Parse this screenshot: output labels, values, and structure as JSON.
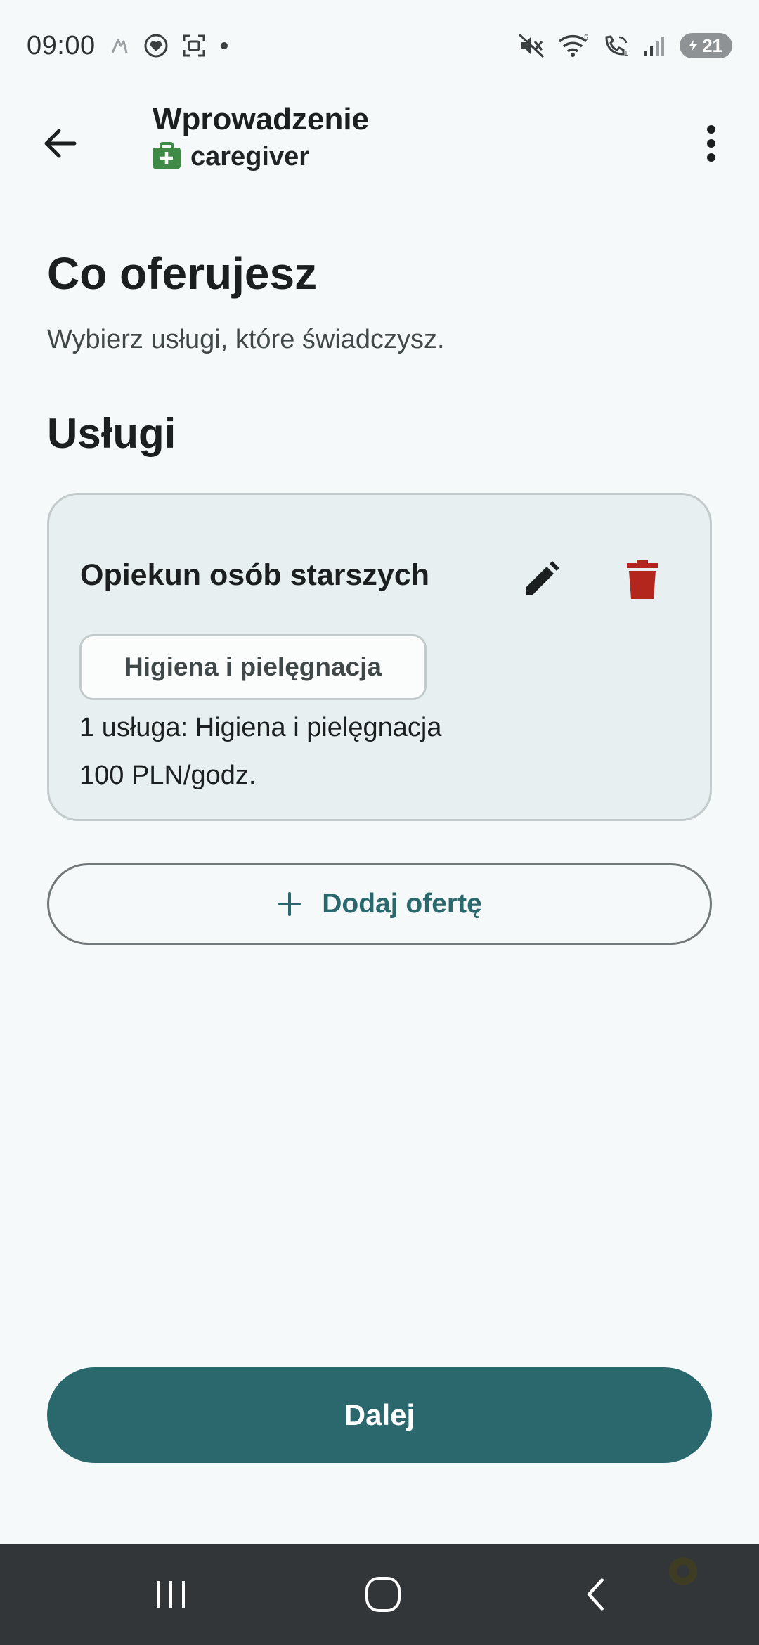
{
  "status_bar": {
    "time": "09:00",
    "battery_level": "21",
    "icons": [
      "assistant-icon",
      "heart-icon",
      "screenshot-icon",
      "dot-icon",
      "mute-icon",
      "wifi-icon",
      "wifi-calling-icon",
      "signal-icon",
      "battery-icon"
    ]
  },
  "app_bar": {
    "title": "Wprowadzenie",
    "role": "caregiver",
    "role_icon": "medical-kit-icon",
    "role_icon_color": "#3f8a47"
  },
  "page": {
    "heading": "Co oferujesz",
    "description": "Wybierz usługi, które świadczysz.",
    "section_title": "Usługi"
  },
  "services": [
    {
      "title": "Opiekun osób starszych",
      "chip": "Higiena i pielęgnacja",
      "summary": "1 usługa: Higiena i pielęgnacja",
      "price": "100 PLN/godz.",
      "edit_icon": "pencil-icon",
      "delete_icon": "trash-icon",
      "delete_color": "#b3261e"
    }
  ],
  "actions": {
    "add_offer": "Dodaj ofertę",
    "next": "Dalej"
  },
  "colors": {
    "primary": "#2b686e",
    "background": "#f5f9fa",
    "card_background": "#e8eff0"
  },
  "nav_bar": {
    "buttons": [
      "recent-apps-icon",
      "home-icon",
      "back-icon"
    ]
  }
}
